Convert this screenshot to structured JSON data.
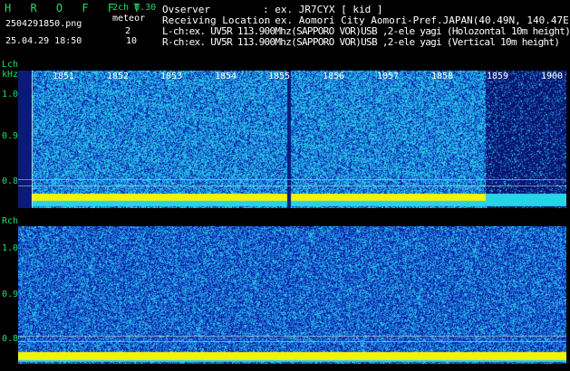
{
  "app": {
    "logo": "H R O F F T",
    "mode": "2ch 0.30",
    "target": "meteor",
    "filename": "2504291850.png",
    "datetime": "25.04.29 18:50",
    "l_count": "2",
    "r_count": "10"
  },
  "info": {
    "observer_label": "Ovserver",
    "observer_value": ": ex. JR7CYX [ kid ]",
    "location_label": "Receiving Location",
    "location_value": ": ex. Aomori City Aomori-Pref.JAPAN(40.49N, 140.47E)",
    "lch_line": "L-ch:ex. UV5R 113.900Mhz(SAPPORO VOR)USB ,2-ele yagi (Holozontal 10m height)",
    "rch_line": "R-ch:ex. UV5R 113.900Mhz(SAPPORO VOR)USB ,2-ele yagi (Vertical 10m height)"
  },
  "lch": {
    "label": "Lch",
    "unit": "kHz",
    "y_ticks": [
      "1.0",
      "0.9",
      "0.8"
    ],
    "time_ticks": [
      "1851",
      "1852",
      "1853",
      "1854",
      "1855",
      "1856",
      "1857",
      "1858",
      "1859",
      "1900"
    ]
  },
  "rch": {
    "label": "Rch",
    "y_ticks": [
      "1.0",
      "0.9",
      "0.8"
    ]
  },
  "colors": {
    "background": "#000000",
    "label_green": "#18e06a",
    "signal_yellow": "#f2f20a",
    "noise_deep": "#0a1ea8",
    "noise_mid": "#1f7bdc",
    "noise_cyan": "#27d4e6"
  }
}
